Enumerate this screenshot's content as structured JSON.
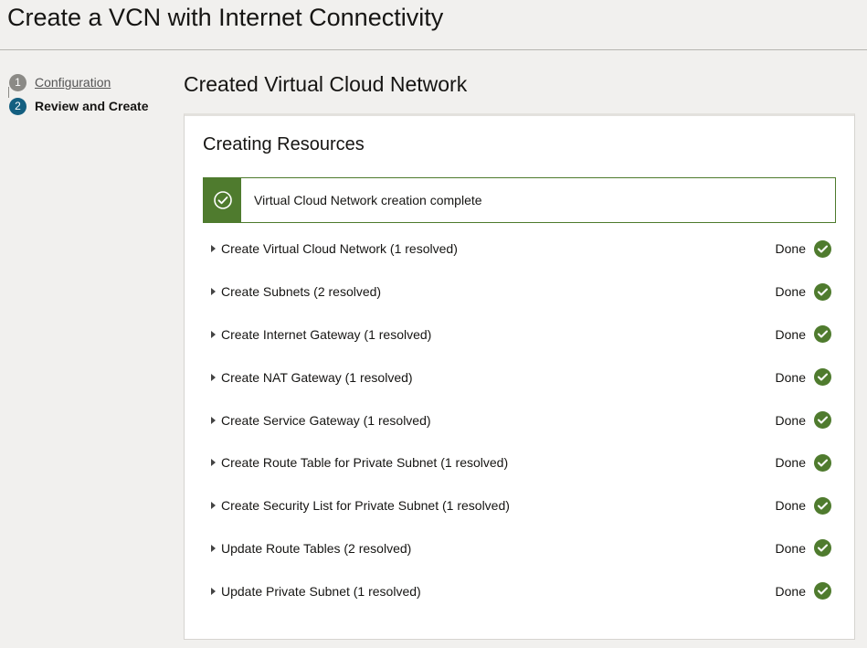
{
  "page": {
    "title": "Create a VCN with Internet Connectivity"
  },
  "steps": [
    {
      "number": "1",
      "label": "Configuration"
    },
    {
      "number": "2",
      "label": "Review and Create"
    }
  ],
  "section": {
    "title": "Created Virtual Cloud Network"
  },
  "card": {
    "title": "Creating Resources",
    "banner": "Virtual Cloud Network creation complete"
  },
  "tasks": [
    {
      "label": "Create Virtual Cloud Network (1 resolved)",
      "status": "Done"
    },
    {
      "label": "Create Subnets (2 resolved)",
      "status": "Done"
    },
    {
      "label": "Create Internet Gateway (1 resolved)",
      "status": "Done"
    },
    {
      "label": "Create NAT Gateway (1 resolved)",
      "status": "Done"
    },
    {
      "label": "Create Service Gateway (1 resolved)",
      "status": "Done"
    },
    {
      "label": "Create Route Table for Private Subnet (1 resolved)",
      "status": "Done"
    },
    {
      "label": "Create Security List for Private Subnet (1 resolved)",
      "status": "Done"
    },
    {
      "label": "Update Route Tables (2 resolved)",
      "status": "Done"
    },
    {
      "label": "Update Private Subnet (1 resolved)",
      "status": "Done"
    }
  ],
  "colors": {
    "success": "#4f7b2e",
    "active_step": "#145f80",
    "completed_step": "#8b8a86",
    "background": "#f1f0ee"
  },
  "icons": {
    "banner": "check-circle-icon",
    "status": "check-circle-icon",
    "expand": "caret-right-icon"
  }
}
